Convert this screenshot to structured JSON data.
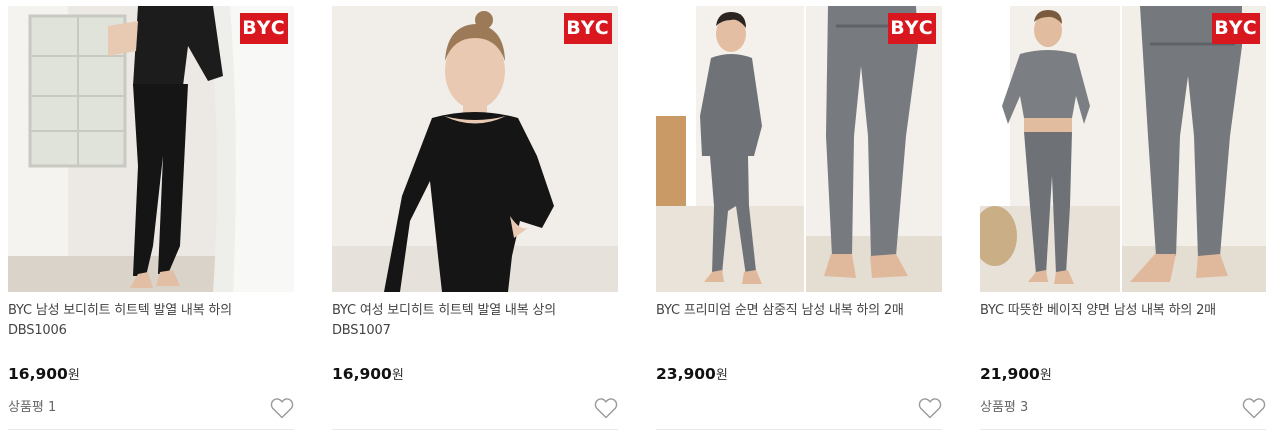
{
  "products": [
    {
      "badge": "BYC",
      "name_line1": "BYC 남성 보디히트 히트텍 발열 내복 하의",
      "name_line2": "DBS1006",
      "price": "16,900",
      "currency": "원",
      "review": "상품평 1"
    },
    {
      "badge": "BYC",
      "name_line1": "BYC 여성 보디히트 히트텍 발열 내복 상의",
      "name_line2": "DBS1007",
      "price": "16,900",
      "currency": "원",
      "review": ""
    },
    {
      "badge": "BYC",
      "name_line1": "BYC 프리미엄 순면 삼중직 남성 내복 하의 2매",
      "name_line2": "",
      "price": "23,900",
      "currency": "원",
      "review": ""
    },
    {
      "badge": "BYC",
      "name_line1": "BYC 따뜻한 베이직 양면 남성 내복 하의 2매",
      "name_line2": "",
      "price": "21,900",
      "currency": "원",
      "review": "상품평 3"
    }
  ],
  "colors": {
    "badge": "#d8171e",
    "price": "#111111",
    "divider": "#e9e9e9",
    "heart_stroke": "#9a9a9a"
  },
  "icons": {
    "wishlist": "heart-outline-icon"
  }
}
